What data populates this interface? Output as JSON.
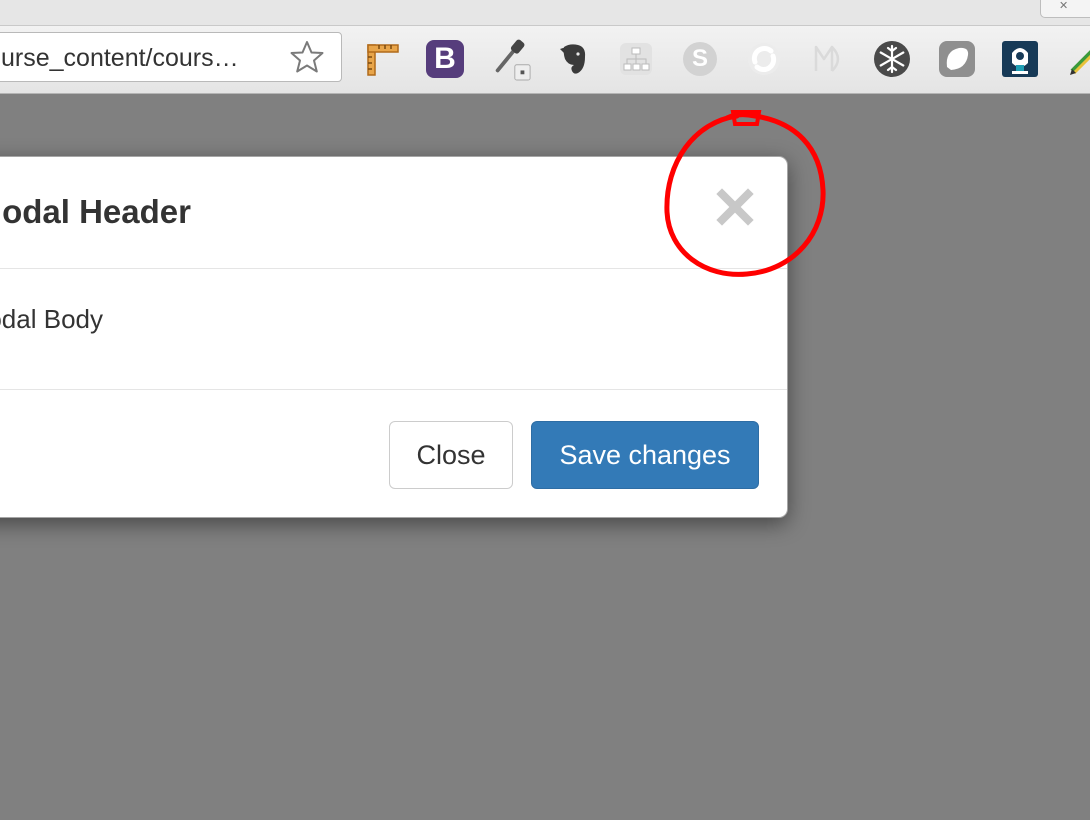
{
  "browser": {
    "address_bar": {
      "url_text": "urse_content/cours…",
      "bookmark_icon": "star-outline-icon"
    },
    "extensions": [
      {
        "name": "ruler-extension-icon",
        "color": "#d08a2e"
      },
      {
        "name": "bootstrap-extension-icon",
        "label": "B",
        "color": "#563d7c"
      },
      {
        "name": "eyedropper-extension-icon",
        "color": "#555555"
      },
      {
        "name": "evernote-extension-icon",
        "color": "#333333"
      },
      {
        "name": "sitemap-extension-icon",
        "color": "#cfcfcf"
      },
      {
        "name": "skype-extension-icon",
        "label": "S",
        "color": "#cfcfcf"
      },
      {
        "name": "refresh-extension-icon",
        "color": "#d9d9d9"
      },
      {
        "name": "markdown-extension-icon",
        "color": "#d9d9d9"
      },
      {
        "name": "snowflake-extension-icon",
        "color": "#444444"
      },
      {
        "name": "rounded-square-extension-icon",
        "color": "#9a9a9a"
      },
      {
        "name": "robot-extension-icon",
        "color": "#1b3d5c"
      },
      {
        "name": "pencil-extension-icon",
        "color": "#3a9a3a"
      }
    ]
  },
  "modal": {
    "title": "Modal Header",
    "body": "Modal Body",
    "close_icon": "close-x-icon",
    "buttons": {
      "close_label": "Close",
      "save_label": "Save changes"
    }
  },
  "colors": {
    "overlay": "#808080",
    "primary": "#337ab7",
    "annotation": "#ff0000",
    "close_x": "#c8c8c8"
  }
}
